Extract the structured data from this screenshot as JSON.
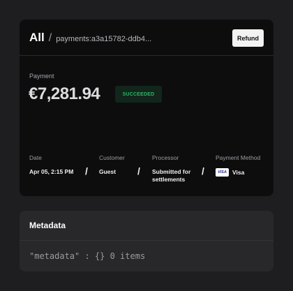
{
  "breadcrumb": {
    "root": "All",
    "separator": "/",
    "current": "payments:a3a15782-ddb4..."
  },
  "actions": {
    "refund_label": "Refund"
  },
  "payment": {
    "label": "Payment",
    "amount": "€7,281.94",
    "status": "SUCCEEDED",
    "status_color": "#2eb366"
  },
  "details": {
    "separator": "/",
    "date": {
      "label": "Date",
      "value": "Apr 05, 2:15 PM"
    },
    "customer": {
      "label": "Customer",
      "value": "Guest"
    },
    "processor": {
      "label": "Processor",
      "value_line1": "Submitted for",
      "value_line2": "settlements"
    },
    "payment_method": {
      "label": "Payment Method",
      "card_brand": "VISA",
      "value": "Visa",
      "icon": "visa-card-icon"
    }
  },
  "metadata": {
    "title": "Metadata",
    "content": "\"metadata\" : {} 0 items"
  }
}
